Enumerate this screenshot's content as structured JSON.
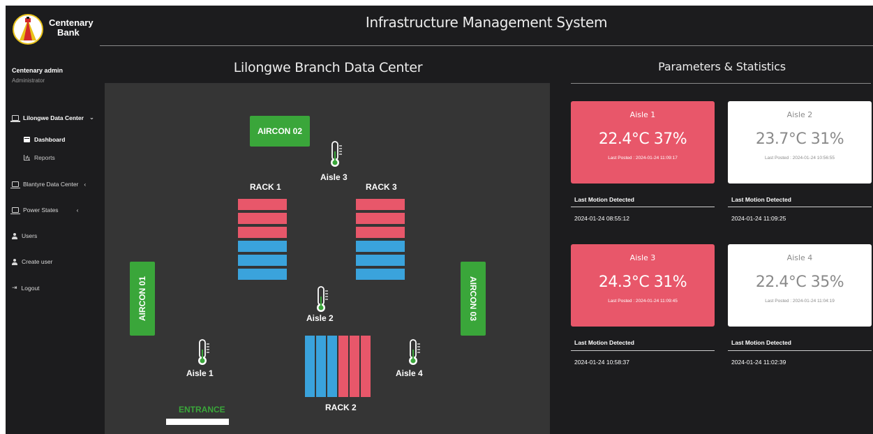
{
  "app": {
    "title": "Infrastructure Management System",
    "brand_line1": "Centenary",
    "brand_line2": "Bank"
  },
  "user": {
    "name": "Centenary admin",
    "role": "Administrator"
  },
  "sidebar": {
    "items": [
      {
        "label": "Lilongwe Data Center",
        "caret": "⌄",
        "icon": "monitor-icon"
      },
      {
        "label": "Blantyre Data Center",
        "caret": "‹",
        "icon": "monitor-icon"
      },
      {
        "label": "Power States",
        "caret": "‹",
        "icon": "monitor-icon"
      },
      {
        "label": "Users",
        "icon": "user-icon"
      },
      {
        "label": "Create user",
        "icon": "user-icon"
      },
      {
        "label": "Logout",
        "icon": "logout-icon"
      }
    ],
    "subitems": [
      {
        "label": "Dashboard",
        "icon": "dashboard-icon"
      },
      {
        "label": "Reports",
        "icon": "chart-icon"
      }
    ]
  },
  "floorplan": {
    "title": "Lilongwe Branch Data Center",
    "aircons": [
      "AIRCON 01",
      "AIRCON 02",
      "AIRCON 03"
    ],
    "racks": [
      "RACK 1",
      "RACK 2",
      "RACK 3"
    ],
    "aisles": [
      "Aisle 1",
      "Aisle 2",
      "Aisle 3",
      "Aisle 4"
    ],
    "entrance": "ENTRANCE",
    "colors": {
      "hot": "#e8576a",
      "cold": "#3aa3dc",
      "aircon": "#3aa63a",
      "floor": "#353535"
    }
  },
  "stats": {
    "title": "Parameters & Statistics",
    "cards": [
      {
        "aisle": "Aisle 1",
        "reading": "22.4°C  37%",
        "posted": "Last Posted : 2024-01-24 11:09:17",
        "status": "alert",
        "motion_label": "Last Motion Detected",
        "motion": "2024-01-24 08:55:12"
      },
      {
        "aisle": "Aisle 2",
        "reading": "23.7°C  31%",
        "posted": "Last Posted : 2024-01-24 10:56:55",
        "status": "normal",
        "motion_label": "Last Motion Detected",
        "motion": "2024-01-24 11:09:25"
      },
      {
        "aisle": "Aisle 3",
        "reading": "24.3°C  31%",
        "posted": "Last Posted : 2024-01-24 11:09:45",
        "status": "alert",
        "motion_label": "Last Motion Detected",
        "motion": "2024-01-24 10:58:37"
      },
      {
        "aisle": "Aisle 4",
        "reading": "22.4°C  35%",
        "posted": "Last Posted : 2024-01-24 11:04:19",
        "status": "normal",
        "motion_label": "Last Motion Detected",
        "motion": "2024-01-24 11:02:39"
      }
    ]
  }
}
